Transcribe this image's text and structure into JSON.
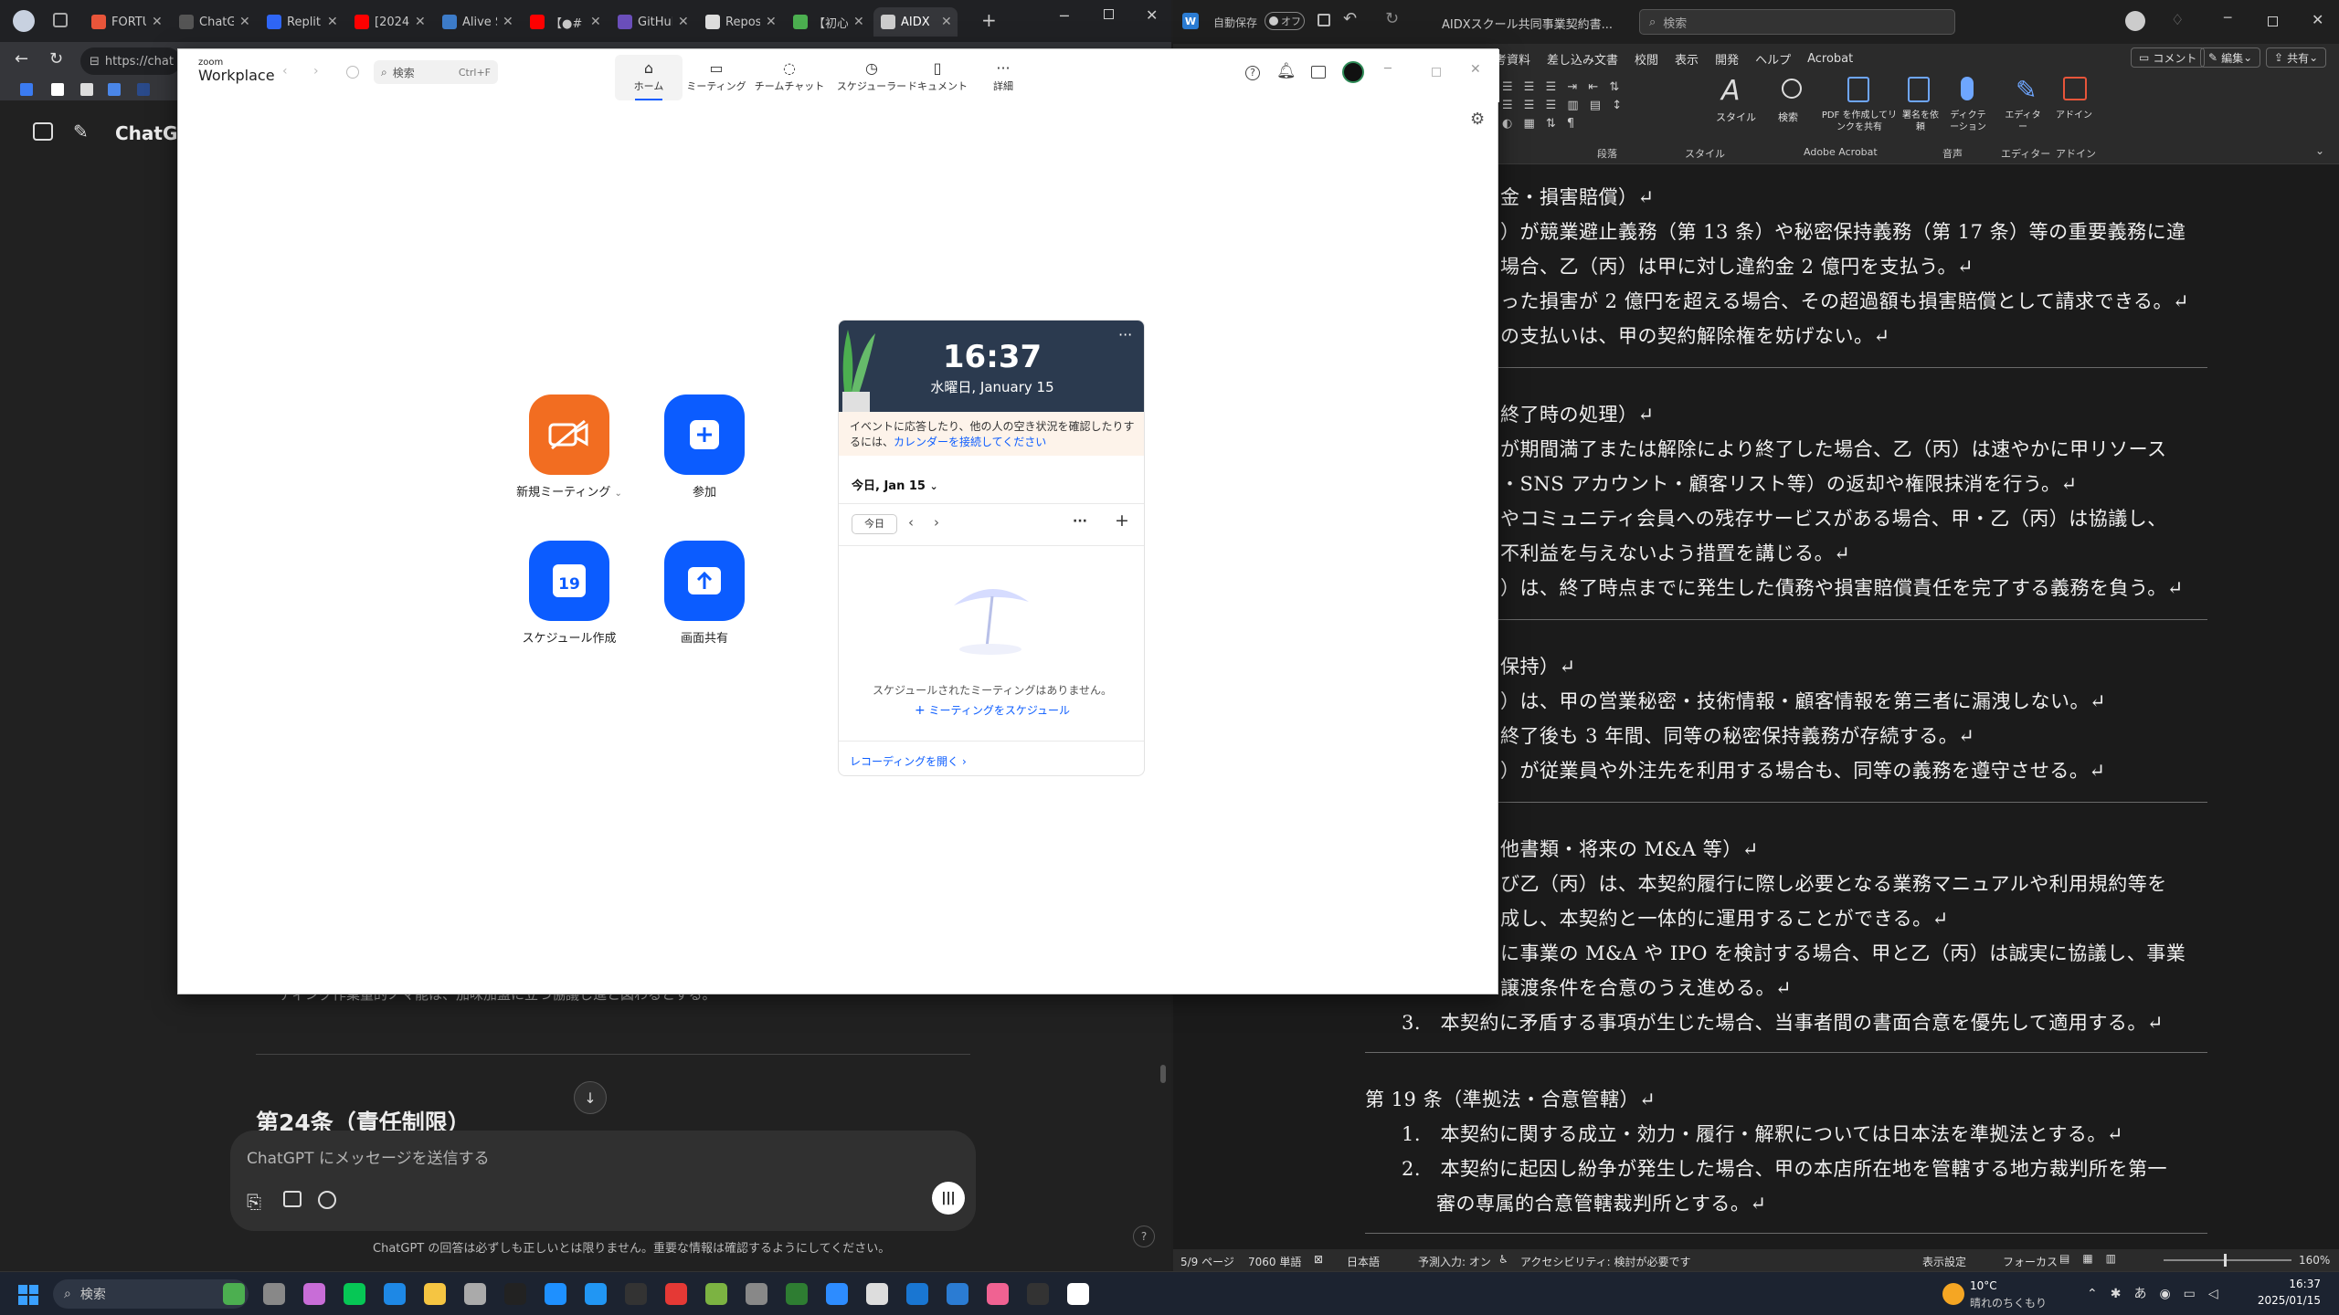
{
  "browser": {
    "tabs": [
      {
        "label": "FORTU",
        "color": "#e8553a",
        "active": false
      },
      {
        "label": "ChatG",
        "color": "#555555",
        "active": false
      },
      {
        "label": "Replit",
        "color": "#2f66f6",
        "active": false
      },
      {
        "label": "[2024",
        "color": "#ff0000",
        "active": false
      },
      {
        "label": "Alive S",
        "color": "#3d7cc9",
        "active": false
      },
      {
        "label": "【●#",
        "color": "#ff0000",
        "active": false
      },
      {
        "label": "GitHub",
        "color": "#6b4fbb",
        "active": false
      },
      {
        "label": "Repos",
        "color": "#dddddd",
        "active": false
      },
      {
        "label": "【初心",
        "color": "#4caf50",
        "active": false
      },
      {
        "label": "AIDX",
        "color": "#cccccc",
        "active": true
      }
    ],
    "new_tab": "+",
    "url": "https://chat",
    "chatgpt": {
      "brand": "ChatGPT",
      "behind_text": "ーディング作業量的ノマ能は、加味加盟に立つ協議し進と図わるとする。",
      "heading": "第24条（責任制限）",
      "input_placeholder": "ChatGPT にメッセージを送信する",
      "disclaimer": "ChatGPT の回答は必ずしも正しいとは限りません。重要な情報は確認するようにしてください。",
      "help": "?"
    }
  },
  "zoom": {
    "logo_top": "zoom",
    "logo_bottom": "Workplace",
    "search_placeholder": "検索",
    "search_shortcut": "Ctrl+F",
    "nav": [
      {
        "label": "ホーム",
        "icon": "home-icon",
        "selected": true
      },
      {
        "label": "ミーティング",
        "icon": "video-icon",
        "selected": false
      },
      {
        "label": "チームチャット",
        "icon": "chat-icon",
        "selected": false
      },
      {
        "label": "スケジューラー",
        "icon": "clock-icon",
        "selected": false
      },
      {
        "label": "ドキュメント",
        "icon": "document-icon",
        "selected": false
      },
      {
        "label": "詳細",
        "icon": "more-icon",
        "selected": false
      }
    ],
    "actions": {
      "new_meeting": "新規ミーティング",
      "join": "参加",
      "schedule": "スケジュール作成",
      "share": "画面共有",
      "schedule_day": "19"
    },
    "calendar": {
      "time": "16:37",
      "date": "水曜日, January 15",
      "notice": "イベントに応答したり、他の人の空き状況を確認したりするには、",
      "notice_link": "カレンダーを接続してください",
      "today_header": "今日, Jan 15",
      "today_button": "今日",
      "empty": "スケジュールされたミーティングはありません。",
      "schedule_link": "ミーティングをスケジュール",
      "recordings": "レコーディングを開く"
    }
  },
  "word": {
    "autosave_label": "自動保存",
    "autosave_state": "オフ",
    "title": "AIDXスクール共同事業契約書...",
    "search_placeholder": "検索",
    "menu": [
      "考資料",
      "差し込み文書",
      "校閲",
      "表示",
      "開発",
      "ヘルプ",
      "Acrobat"
    ],
    "comment_button": "コメント",
    "edit_button": "編集",
    "share_button": "共有",
    "ribbon_groups": [
      "段落",
      "スタイル",
      "Adobe Acrobat",
      "音声",
      "エディター",
      "アドイン"
    ],
    "ribbon_buttons": [
      "スタイル",
      "検索",
      "PDF を作成してリンクを共有",
      "署名を依頼",
      "ディクテーション",
      "エディター",
      "アドイン"
    ],
    "lines": [
      {
        "text": "金・損害賠償）↵",
        "type": "h"
      },
      {
        "text": "）が競業避止義務（第 13 条）や秘密保持義務（第 17 条）等の重要義務に違",
        "type": "p"
      },
      {
        "text": "場合、乙（丙）は甲に対し違約金 2 億円を支払う。↵",
        "type": "p"
      },
      {
        "text": "った損害が 2 億円を超える場合、その超過額も損害賠償として請求できる。↵",
        "type": "p"
      },
      {
        "text": "の支払いは、甲の契約解除権を妨げない。↵",
        "type": "p"
      },
      {
        "text": "",
        "type": "sep"
      },
      {
        "text": "終了時の処理）↵",
        "type": "h"
      },
      {
        "text": "が期間満了または解除により終了した場合、乙（丙）は速やかに甲リソース",
        "type": "p"
      },
      {
        "text": "・SNS アカウント・顧客リスト等）の返却や権限抹消を行う。↵",
        "type": "p"
      },
      {
        "text": "やコミュニティ会員への残存サービスがある場合、甲・乙（丙）は協議し、",
        "type": "p"
      },
      {
        "text": "不利益を与えないよう措置を講じる。↵",
        "type": "p"
      },
      {
        "text": "）は、終了時点までに発生した債務や損害賠償責任を完了する義務を負う。↵",
        "type": "p"
      },
      {
        "text": "",
        "type": "sep"
      },
      {
        "text": "保持）↵",
        "type": "h"
      },
      {
        "text": "）は、甲の営業秘密・技術情報・顧客情報を第三者に漏洩しない。↵",
        "type": "p"
      },
      {
        "text": "終了後も 3 年間、同等の秘密保持義務が存続する。↵",
        "type": "p"
      },
      {
        "text": "）が従業員や外注先を利用する場合も、同等の義務を遵守させる。↵",
        "type": "p"
      },
      {
        "text": "",
        "type": "sep"
      },
      {
        "text": "他書類・将来の M&A 等）↵",
        "type": "h"
      },
      {
        "text": "び乙（丙）は、本契約履行に際し必要となる業務マニュアルや利用規約等を",
        "type": "p"
      },
      {
        "text": "成し、本契約と一体的に運用することができる。↵",
        "type": "p"
      },
      {
        "text": "に事業の M&A や IPO を検討する場合、甲と乙（丙）は誠実に協議し、事業",
        "type": "p"
      },
      {
        "text": "譲渡条件を合意のうえ進める。↵",
        "type": "p"
      },
      {
        "text": "3.　本契約に矛盾する事項が生じた場合、当事者間の書面合意を優先して適用する。↵",
        "type": "p2"
      },
      {
        "text": "",
        "type": "sep"
      },
      {
        "text": "第 19 条（準拠法・合意管轄）↵",
        "type": "h2"
      },
      {
        "text": "1.　本契約に関する成立・効力・履行・解釈については日本法を準拠法とする。↵",
        "type": "p2"
      },
      {
        "text": "2.　本契約に起因し紛争が発生した場合、甲の本店所在地を管轄する地方裁判所を第一",
        "type": "p2"
      },
      {
        "text": "審の専属的合意管轄裁判所とする。↵",
        "type": "p3"
      },
      {
        "text": "",
        "type": "sep"
      }
    ],
    "status": {
      "page": "5/9 ページ",
      "words": "7060 単語",
      "lang": "日本語",
      "ime": "予測入力: オン",
      "accessibility": "アクセシビリティ: 検討が必要です",
      "display": "表示設定",
      "focus": "フォーカス",
      "zoom": "160%"
    }
  },
  "taskbar": {
    "search": "検索",
    "weather_temp": "10°C",
    "weather_desc": "晴れのちくもり",
    "time": "16:37",
    "date": "2025/01/15"
  }
}
